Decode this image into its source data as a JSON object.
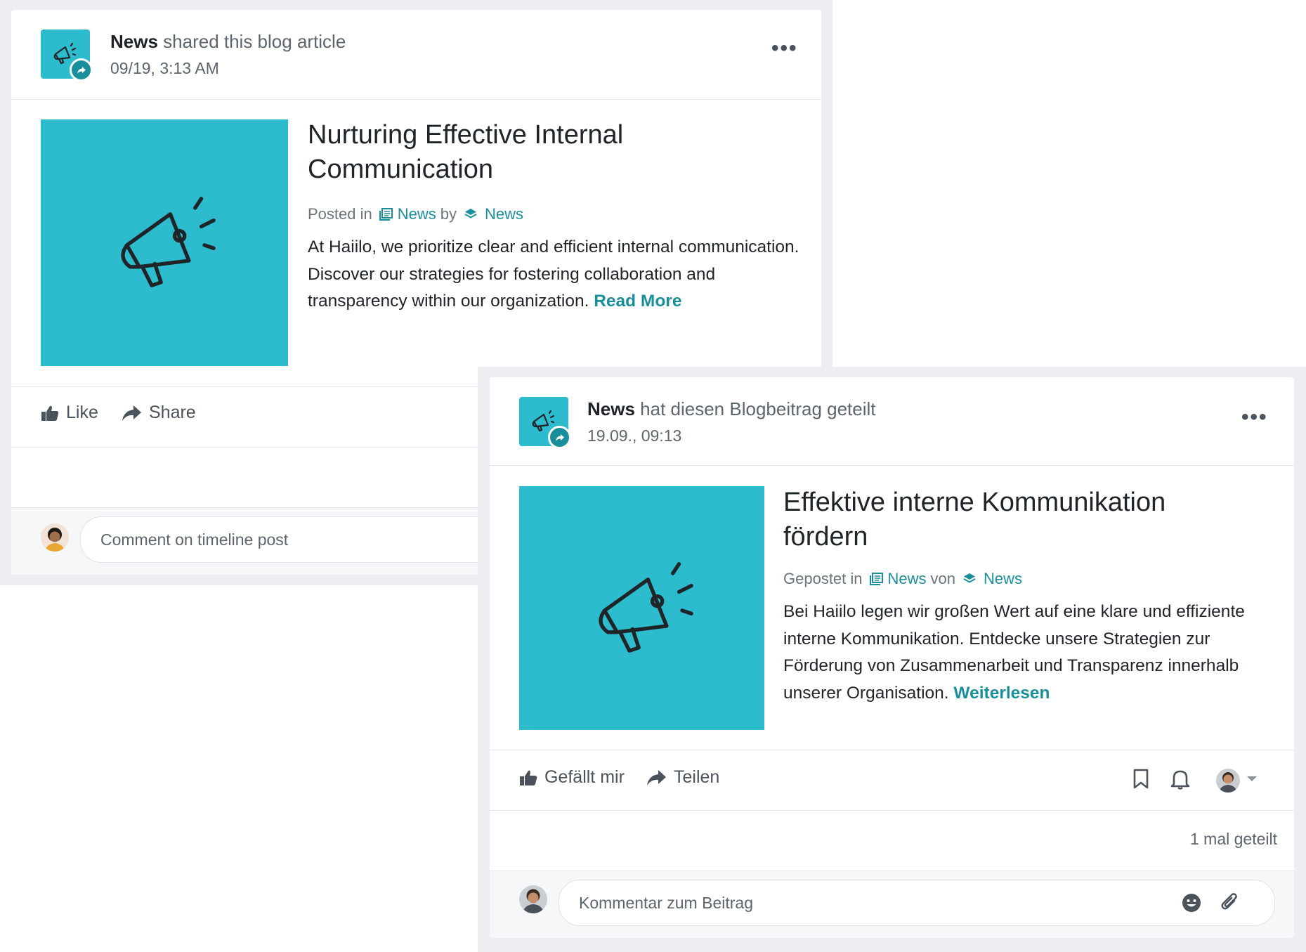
{
  "post_en": {
    "author": "News",
    "action_text": "shared this blog article",
    "timestamp": "09/19, 3:13 AM",
    "menu_icon": "more-horizontal-icon",
    "title_line1": "Nurturing Effective Internal",
    "title_line2": "Communication",
    "posted_in": "Posted in",
    "channel": "News",
    "by": "by",
    "by_author": "News",
    "excerpt": "At Haiilo, we prioritize clear and efficient internal communication. Discover our strategies for fostering collaboration and transparency within our organization.",
    "read_more": "Read More",
    "like_label": "Like",
    "share_label": "Share",
    "comment_placeholder": "Comment on timeline post"
  },
  "post_de": {
    "author": "News",
    "action_text": "hat diesen Blogbeitrag geteilt",
    "timestamp": "19.09., 09:13",
    "menu_icon": "more-horizontal-icon",
    "title_line1": "Effektive interne Kommunikation",
    "title_line2": "fördern",
    "posted_in": "Gepostet in",
    "channel": "News",
    "by": "von",
    "by_author": "News",
    "excerpt": "Bei Haiilo legen wir großen Wert auf eine klare und effiziente interne Kommunikation. Entdecke unsere Strategien zur Förderung von Zusammenarbeit und Transparenz innerhalb unserer Organisation.",
    "read_more": "Weiterlesen",
    "like_label": "Gefällt mir",
    "share_label": "Teilen",
    "shared_count": "1 mal geteilt",
    "comment_placeholder": "Kommentar zum Beitrag"
  },
  "colors": {
    "accent": "#1a8f9c",
    "tile": "#2dbccd",
    "frame": "#eceef1"
  }
}
